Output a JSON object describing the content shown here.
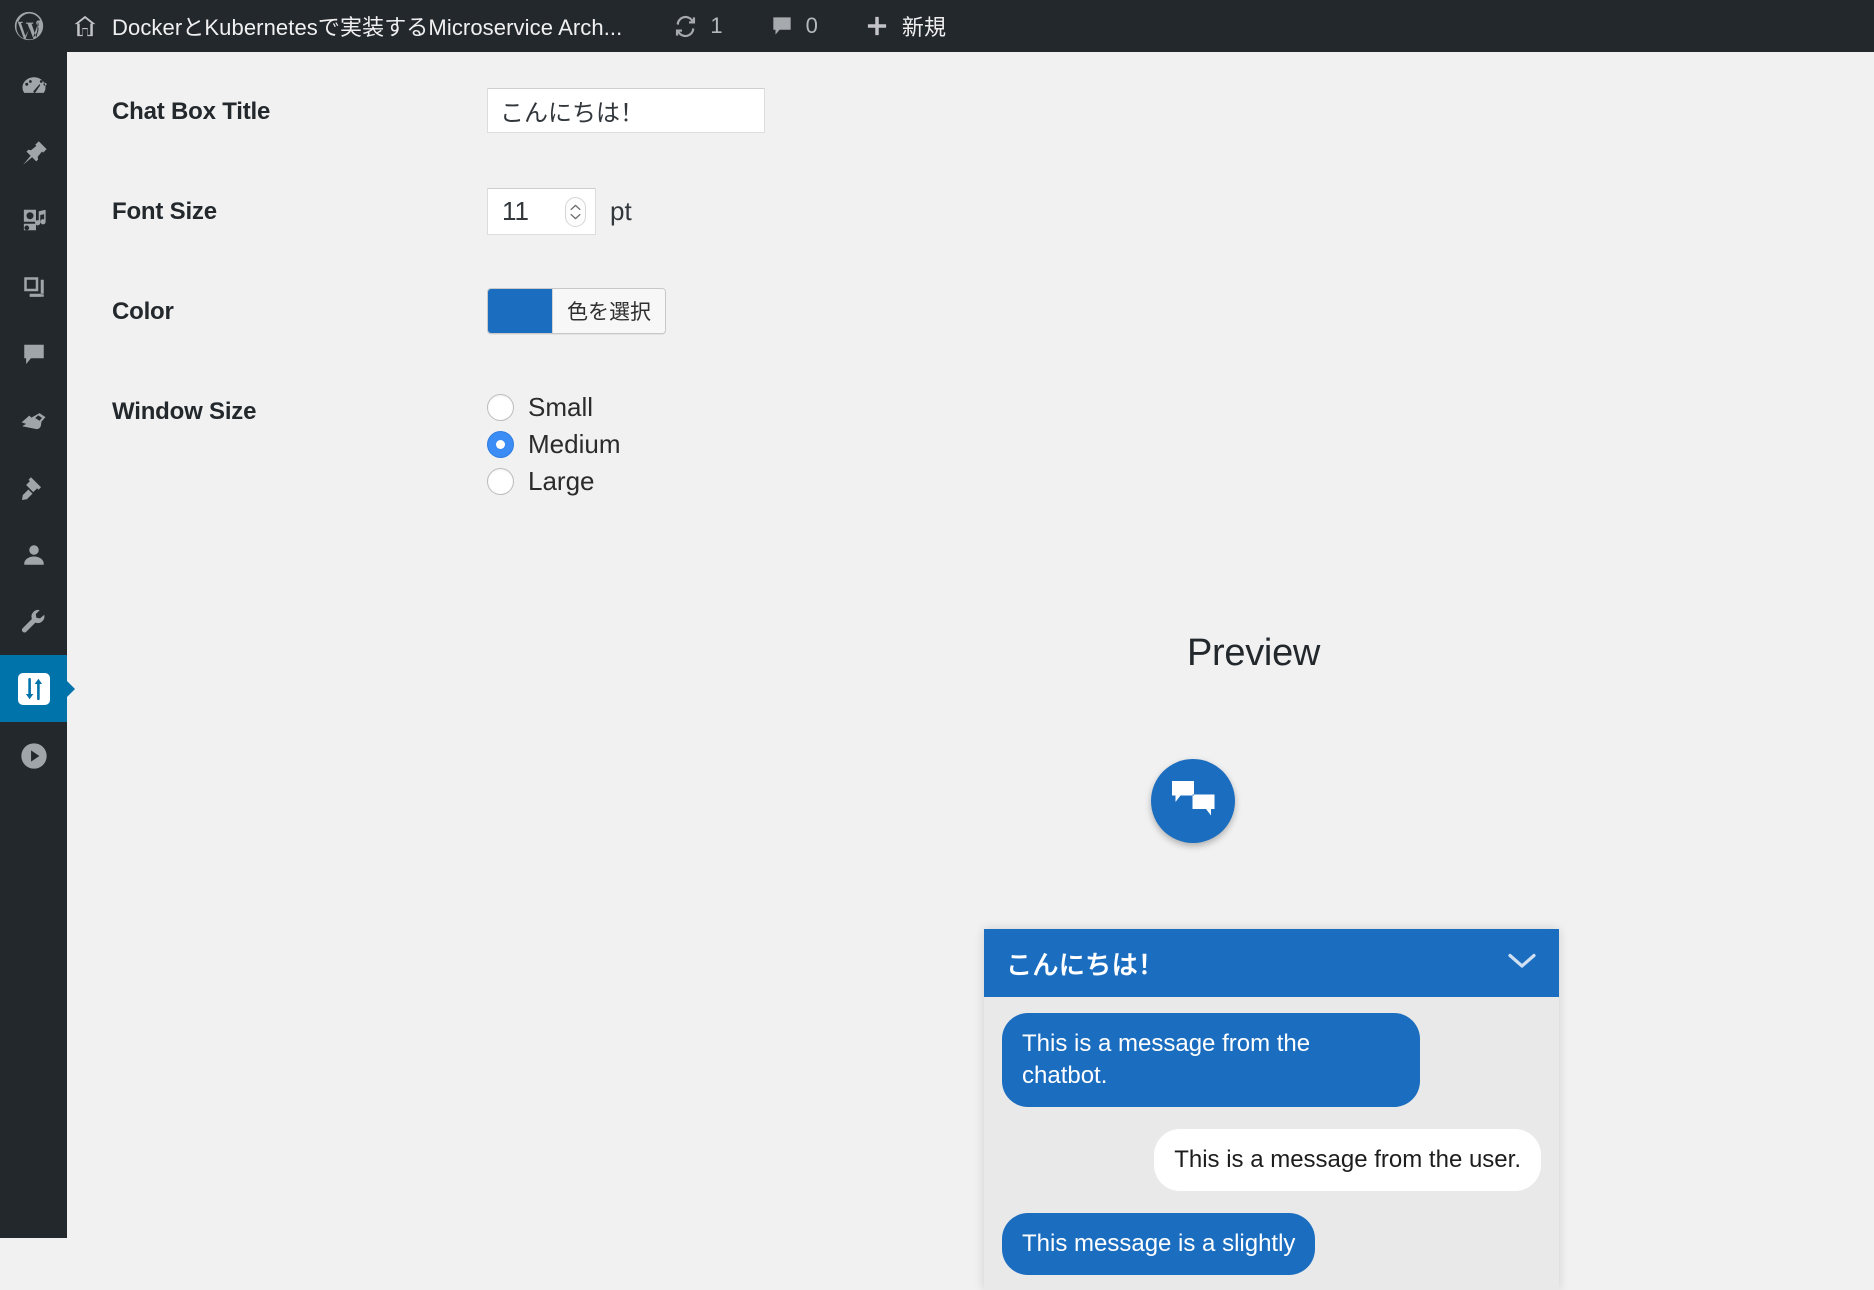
{
  "admin_bar": {
    "wp_logo_icon": "wordpress-logo-icon",
    "home_icon": "home-icon",
    "site_title": "DockerとKubernetesで実装するMicroservice Arch...",
    "updates_icon": "updates-icon",
    "updates_count": "1",
    "comments_icon": "comment-bubble-icon",
    "comments_count": "0",
    "new_icon": "plus-icon",
    "new_label": "新規"
  },
  "sidebar": {
    "active_index": 9,
    "items": [
      {
        "icon": "dashboard-gauge-icon",
        "name": "sidebar-item-dashboard"
      },
      {
        "icon": "pin-icon",
        "name": "sidebar-item-posts"
      },
      {
        "icon": "media-icon",
        "name": "sidebar-item-media"
      },
      {
        "icon": "pages-icon",
        "name": "sidebar-item-pages"
      },
      {
        "icon": "comment-icon",
        "name": "sidebar-item-comments"
      },
      {
        "icon": "paintbrush-icon",
        "name": "sidebar-item-appearance"
      },
      {
        "icon": "plug-icon",
        "name": "sidebar-item-plugins"
      },
      {
        "icon": "user-icon",
        "name": "sidebar-item-users"
      },
      {
        "icon": "wrench-icon",
        "name": "sidebar-item-tools"
      },
      {
        "icon": "sliders-settings-icon",
        "name": "sidebar-item-settings"
      },
      {
        "icon": "play-circle-icon",
        "name": "sidebar-item-plugin-player"
      }
    ]
  },
  "settings": {
    "chat_box_title": {
      "label": "Chat Box Title",
      "value": "こんにちは！",
      "placeholder": ""
    },
    "font_size": {
      "label": "Font Size",
      "value": "11",
      "unit": "pt"
    },
    "color": {
      "label": "Color",
      "swatch_hex": "#1b6dc0",
      "button_label": "色を選択"
    },
    "window_size": {
      "label": "Window Size",
      "selected": "Medium",
      "options": [
        "Small",
        "Medium",
        "Large"
      ]
    }
  },
  "preview": {
    "heading": "Preview",
    "launcher_icon": "chat-bubbles-icon",
    "chat_window": {
      "header_title": "こんにちは！",
      "collapse_icon": "chevron-down-icon",
      "header_color": "#1b6dc0",
      "messages": [
        {
          "from": "bot",
          "text": "This is a message from the chatbot."
        },
        {
          "from": "user",
          "text": "This is a message from the user."
        },
        {
          "from": "bot",
          "text": "This message is a slightly"
        }
      ]
    }
  },
  "colors": {
    "admin_dark": "#23282d",
    "admin_active_blue": "#0073aa",
    "accent_blue": "#1b6dc0",
    "radio_blue": "#3b8cf4",
    "page_bg": "#f1f1f1"
  }
}
